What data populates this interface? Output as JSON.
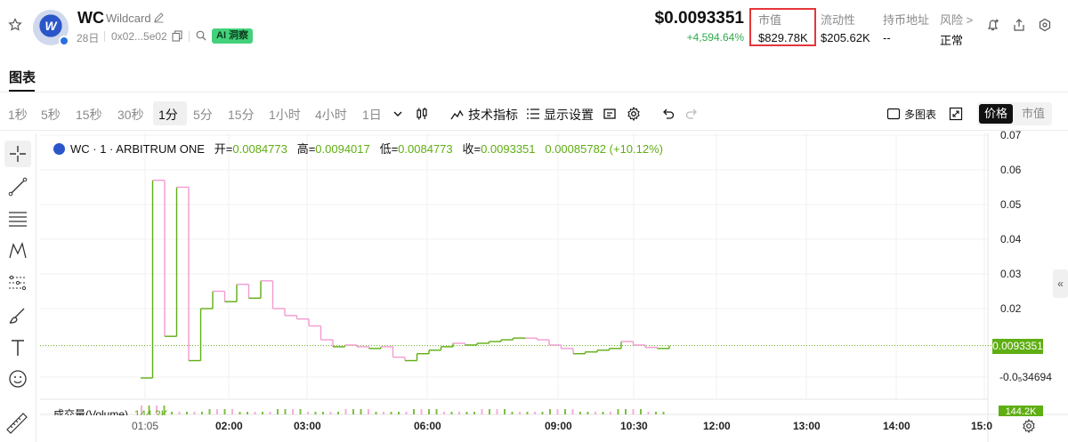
{
  "header": {
    "symbol": "WC",
    "name": "Wildcard",
    "age": "28日",
    "address": "0x02...5e02",
    "ai_badge": "AI 洞察",
    "logo_letter": "W",
    "price": "$0.0093351",
    "change": "+4,594.64%",
    "stats": [
      {
        "label": "市值",
        "value": "$829.78K"
      },
      {
        "label": "流动性",
        "value": "$205.62K"
      },
      {
        "label": "持币地址",
        "value": "--"
      },
      {
        "label": "风险 >",
        "value": "正常"
      }
    ],
    "highlight_color": "#e5363a"
  },
  "tabs": {
    "chart": "图表"
  },
  "toolbar": {
    "timeframes": [
      "1秒",
      "5秒",
      "15秒",
      "30秒",
      "1分",
      "5分",
      "15分",
      "1小时",
      "4小时",
      "1日"
    ],
    "active_timeframe": "1分",
    "indicators": "技术指标",
    "display_settings": "显示设置",
    "multi_chart": "多图表",
    "toggle_price": "价格",
    "toggle_mcap": "市值"
  },
  "legend": {
    "title": "WC · 1 · ARBITRUM ONE",
    "open_label": "开=",
    "open": "0.0084773",
    "high_label": "高=",
    "high": "0.0094017",
    "low_label": "低=",
    "low": "0.0084773",
    "close_label": "收=",
    "close": "0.0093351",
    "delta": "0.00085782 (+10.12%)"
  },
  "volume": {
    "label": "成交量(Volume)",
    "value": "144.2K",
    "tag": "144.2K"
  },
  "chart_data": {
    "type": "candlestick",
    "up_color": "#5fae12",
    "down_color": "#f29bd0",
    "y_ticks": [
      "0.07",
      "0.06",
      "0.05",
      "0.04",
      "0.03",
      "0.02",
      "-0.0₅34694"
    ],
    "last_price_tag": "0.0093351",
    "x_ticks": [
      "01:05",
      "02:00",
      "03:00",
      "06:00",
      "09:00",
      "10:30",
      "12:00",
      "13:00",
      "14:00",
      "15:0"
    ],
    "ylim": [
      -0.005,
      0.07
    ],
    "series": [
      {
        "x": 0,
        "y": 0.0
      },
      {
        "x": 1,
        "y": 0.057
      },
      {
        "x": 2,
        "y": 0.012
      },
      {
        "x": 3,
        "y": 0.055
      },
      {
        "x": 4,
        "y": 0.005
      },
      {
        "x": 5,
        "y": 0.02
      },
      {
        "x": 6,
        "y": 0.025
      },
      {
        "x": 7,
        "y": 0.022
      },
      {
        "x": 8,
        "y": 0.027
      },
      {
        "x": 9,
        "y": 0.023
      },
      {
        "x": 10,
        "y": 0.028
      },
      {
        "x": 11,
        "y": 0.02
      },
      {
        "x": 12,
        "y": 0.018
      },
      {
        "x": 13,
        "y": 0.017
      },
      {
        "x": 14,
        "y": 0.015
      },
      {
        "x": 15,
        "y": 0.011
      },
      {
        "x": 16,
        "y": 0.009
      },
      {
        "x": 17,
        "y": 0.0095
      },
      {
        "x": 18,
        "y": 0.009
      },
      {
        "x": 19,
        "y": 0.0085
      },
      {
        "x": 20,
        "y": 0.009
      },
      {
        "x": 21,
        "y": 0.006
      },
      {
        "x": 22,
        "y": 0.005
      },
      {
        "x": 23,
        "y": 0.007
      },
      {
        "x": 24,
        "y": 0.008
      },
      {
        "x": 25,
        "y": 0.009
      },
      {
        "x": 26,
        "y": 0.01
      },
      {
        "x": 27,
        "y": 0.0095
      },
      {
        "x": 28,
        "y": 0.01
      },
      {
        "x": 29,
        "y": 0.0105
      },
      {
        "x": 30,
        "y": 0.011
      },
      {
        "x": 31,
        "y": 0.0115
      },
      {
        "x": 32,
        "y": 0.0115
      },
      {
        "x": 33,
        "y": 0.011
      },
      {
        "x": 34,
        "y": 0.0095
      },
      {
        "x": 35,
        "y": 0.0085
      },
      {
        "x": 36,
        "y": 0.007
      },
      {
        "x": 37,
        "y": 0.0075
      },
      {
        "x": 38,
        "y": 0.008
      },
      {
        "x": 39,
        "y": 0.0085
      },
      {
        "x": 40,
        "y": 0.0105
      },
      {
        "x": 41,
        "y": 0.0095
      },
      {
        "x": 42,
        "y": 0.0088
      },
      {
        "x": 43,
        "y": 0.0085
      },
      {
        "x": 44,
        "y": 0.0093351
      }
    ]
  }
}
